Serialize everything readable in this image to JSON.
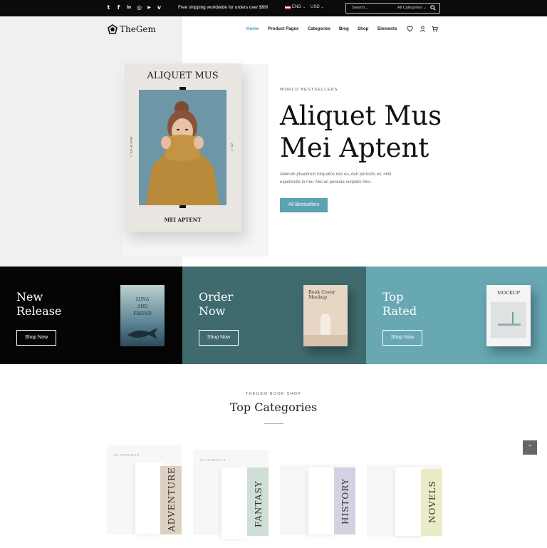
{
  "topbar": {
    "social_icons": [
      "twitter-icon",
      "facebook-icon",
      "linkedin-icon",
      "instagram-icon",
      "youtube-icon",
      "vimeo-icon"
    ],
    "social_glyphs": [
      "t",
      "f",
      "in",
      "◎",
      "▶",
      "v"
    ],
    "shipping_text": "Free shipping worldwide for orders over $99!",
    "language": "ENG",
    "currency": "USD",
    "search_placeholder": "Search...",
    "search_category": "All Categories"
  },
  "header": {
    "logo_text": "TheGem",
    "nav": [
      "Home",
      "Product Pages",
      "Categories",
      "Blog",
      "Shop",
      "Elements"
    ],
    "active_nav": "Home"
  },
  "hero": {
    "book_title": "ALIQUET MUS",
    "book_bottom": "MEI APTENT",
    "book_spine_left": "MOCKUP  VOL. 1",
    "book_spine_right": "VOL. 2",
    "kicker": "WORLD BESTSELLERS",
    "title_line1": "Aliquet Mus",
    "title_line2": "Mei Aptent",
    "description": "Alienum phaedrum torquatos nec eu, detr periculis ex, nihil expetendis in mei. Mei an pericula euripidis hinc.",
    "button": "All Bestsellers"
  },
  "promos": [
    {
      "title_line1": "New",
      "title_line2": "Release",
      "button": "Shop Now",
      "book_text": "LUNA AND FRIEND",
      "book_sub": "NOVEL",
      "bg": "#050505"
    },
    {
      "title_line1": "Order",
      "title_line2": "Now",
      "button": "Shop Now",
      "book_text": "Book Cover Mockup",
      "bg": "#3f6b6f"
    },
    {
      "title_line1": "Top",
      "title_line2": "Rated",
      "button": "Shop Now",
      "book_text": "MOCKUP",
      "bg": "#67a8b3"
    }
  ],
  "categories": {
    "kicker": "THEGEM BOOK SHOP",
    "title": "Top Categories",
    "items": [
      {
        "label": "ADVENTURE",
        "count": "20 PRODUCTS",
        "spine_color": "#ddd0c3"
      },
      {
        "label": "FANTASY",
        "count": "20 PRODUCTS",
        "spine_color": "#cfdfd6"
      },
      {
        "label": "HISTORY",
        "count": "",
        "spine_color": "#d2d2e3"
      },
      {
        "label": "NOVELS",
        "count": "",
        "spine_color": "#ecebc8"
      }
    ]
  },
  "colors": {
    "accent": "#5aa3b1",
    "nav_active": "#3ba6b5",
    "topbar_bg": "#0b0b0b"
  }
}
